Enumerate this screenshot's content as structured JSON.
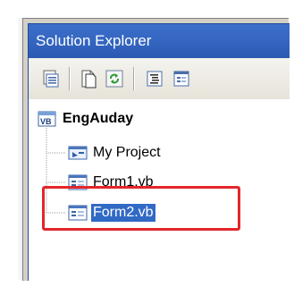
{
  "panel": {
    "title": "Solution Explorer"
  },
  "toolbar": {
    "buttons": [
      {
        "icon": "properties-icon"
      },
      {
        "icon": "show-all-files-icon"
      },
      {
        "icon": "refresh-icon"
      },
      {
        "icon": "view-code-icon"
      },
      {
        "icon": "view-designer-icon"
      }
    ]
  },
  "tree": {
    "project": {
      "label": "EngAuday",
      "icon": "vb-project-icon"
    },
    "items": [
      {
        "label": "My Project",
        "icon": "my-project-icon"
      },
      {
        "label": "Form1.vb",
        "icon": "form-icon"
      },
      {
        "label": "Form2.vb",
        "icon": "form-icon",
        "selected": true
      }
    ]
  },
  "colors": {
    "title_bar": "#3567c2",
    "selection": "#316ac5",
    "highlight_box": "#e3262b",
    "frame": "#d4d0c8"
  }
}
